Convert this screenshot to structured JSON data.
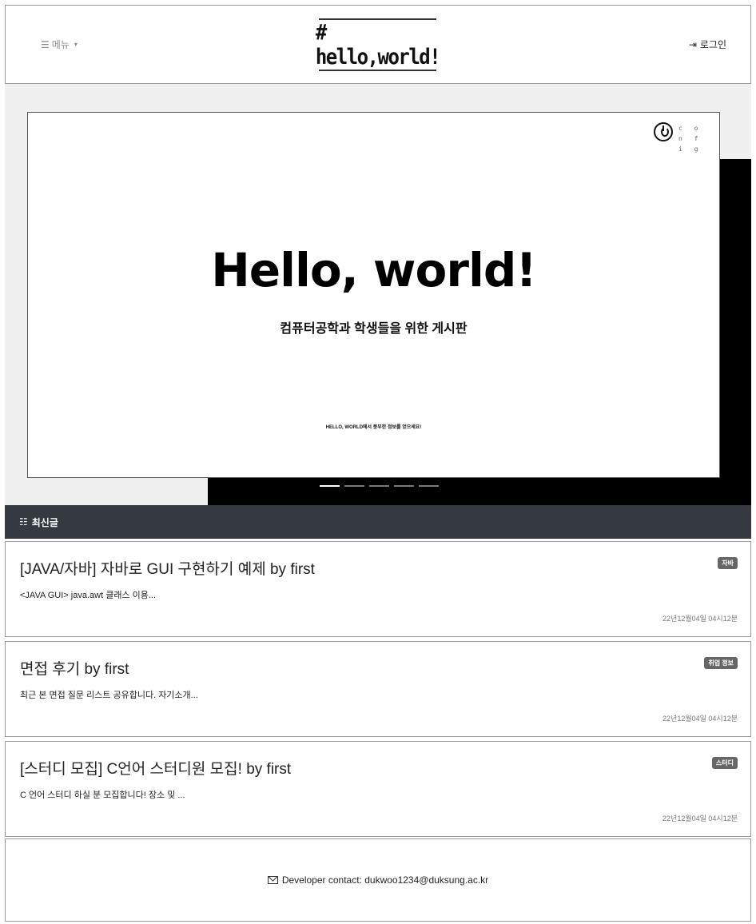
{
  "header": {
    "menu_icon": "☰",
    "menu_label": "메뉴",
    "menu_caret": "▾",
    "logo": "# hello,world!",
    "login_icon": "⇥",
    "login_label": "로그인"
  },
  "hero": {
    "config_label": "c o n f i g",
    "title": "Hello, world!",
    "subtitle": "컴퓨터공학과 학생들을 위한 게시판",
    "caption": "HELLO, WORLD에서 풍부한 정보를 얻으세요!",
    "indicator_count": 5,
    "active_indicator": 0
  },
  "section": {
    "icon": "☷",
    "title": "최신글"
  },
  "posts": [
    {
      "title": "[JAVA/자바] 자바로 GUI 구현하기 예제 by first",
      "badge": "자바",
      "excerpt": "<JAVA GUI> java.awt 클래스 이용...",
      "date": "22년12월04일 04시12분"
    },
    {
      "title": "면접 후기 by first",
      "badge": "취업 정보",
      "excerpt": "최근 본 면접 질문 리스트 공유합니다. 자기소개...",
      "date": "22년12월04일 04시12분"
    },
    {
      "title": "[스터디 모집] C언어 스터디원 모집! by first",
      "badge": "스터디",
      "excerpt": "C 언어 스터디 하실 분 모집합니다! 장소 및 ...",
      "date": "22년12월04일 04시12분"
    }
  ],
  "footer": {
    "contact": "Developer contact: dukwoo1234@duksung.ac.kr"
  }
}
